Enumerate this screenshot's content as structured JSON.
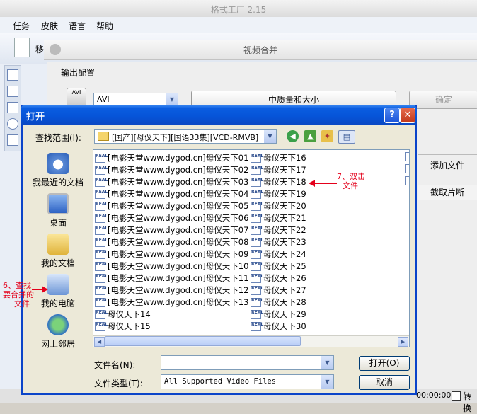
{
  "app": {
    "title": "格式工厂  2.15",
    "menu": [
      "任务",
      "皮肤",
      "语言",
      "帮助"
    ],
    "toolbar_partial": "移",
    "merge_window_title": "视频合并",
    "output_config_label": "输出配置",
    "format_icon_text": "AVI",
    "format_value": "AVI",
    "quality_button": "中质量和大小",
    "ok_button": "确定",
    "add_file_button": "添加文件",
    "clip_column": "截取片断",
    "status_time": "00:00:00",
    "convert_label": "转换"
  },
  "dialog": {
    "title": "打开",
    "help_glyph": "?",
    "close_glyph": "✕",
    "look_in_label": "查找范围(I):",
    "look_in_value": "[国产][母仪天下][国语33集][VCD-RMVB]",
    "places": [
      {
        "label": "我最近的文档"
      },
      {
        "label": "桌面"
      },
      {
        "label": "我的文档"
      },
      {
        "label": "我的电脑"
      },
      {
        "label": "网上邻居"
      }
    ],
    "file_icon_text": "REAL",
    "files_col1": [
      "[电影天堂www.dygod.cn]母仪天下01",
      "[电影天堂www.dygod.cn]母仪天下02",
      "[电影天堂www.dygod.cn]母仪天下03",
      "[电影天堂www.dygod.cn]母仪天下04",
      "[电影天堂www.dygod.cn]母仪天下05",
      "[电影天堂www.dygod.cn]母仪天下06",
      "[电影天堂www.dygod.cn]母仪天下07",
      "[电影天堂www.dygod.cn]母仪天下08",
      "[电影天堂www.dygod.cn]母仪天下09",
      "[电影天堂www.dygod.cn]母仪天下10",
      "[电影天堂www.dygod.cn]母仪天下11",
      "[电影天堂www.dygod.cn]母仪天下12",
      "[电影天堂www.dygod.cn]母仪天下13",
      "母仪天下14",
      "母仪天下15"
    ],
    "files_col2": [
      "母仪天下16",
      "母仪天下17",
      "母仪天下18",
      "母仪天下19",
      "母仪天下20",
      "母仪天下21",
      "母仪天下22",
      "母仪天下23",
      "母仪天下24",
      "母仪天下25",
      "母仪天下26",
      "母仪天下27",
      "母仪天下28",
      "母仪天下29",
      "母仪天下30"
    ],
    "filename_label": "文件名(N):",
    "filename_value": "",
    "filetype_label": "文件类型(T):",
    "filetype_value": "All Supported Video Files",
    "open_button": "打开(O)",
    "cancel_button": "取消"
  },
  "annotations": {
    "step7_line1": "7、双击",
    "step7_line2": "文件",
    "step6_line1": "6、查找",
    "step6_line2": "要合并的",
    "step6_line3": "文件"
  },
  "colors": {
    "dialog_title_blue": "#0a5de0",
    "annotation_red": "#e4001b",
    "dialog_face": "#ece9d8"
  }
}
